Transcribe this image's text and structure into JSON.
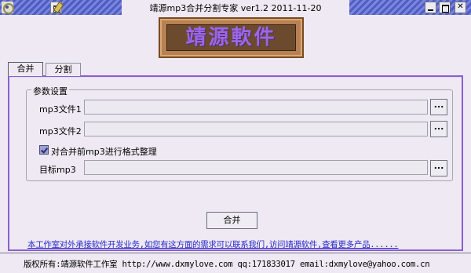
{
  "window": {
    "title": "靖源mp3合并分割专家 ver1.2 2011-11-20",
    "minimize_label": "",
    "maximize_label": "",
    "close_label": "✕"
  },
  "logo": {
    "text": "靖源軟件"
  },
  "tabs": [
    {
      "label": "合并",
      "active": true
    },
    {
      "label": "分割",
      "active": false
    }
  ],
  "group": {
    "label": "参数设置",
    "fields": [
      {
        "label": "mp3文件1",
        "value": "",
        "browse_label": "..."
      },
      {
        "label": "mp3文件2",
        "value": "",
        "browse_label": "..."
      },
      {
        "label": "目标mp3",
        "value": "",
        "browse_label": "..."
      }
    ],
    "checkbox": {
      "label": "对合并前mp3进行格式整理",
      "checked": true
    }
  },
  "merge_button": "合并",
  "promo_link": "本工作室对外承接软件开发业务,如您有这方面的需求可以联系我们,访问靖源软件,查看更多产品......",
  "status_bar": "版权所有:靖源软件工作室 http://www.dxmylove.com qq:171833017 email:dxmylove@yahoo.com.cn",
  "colors": {
    "panel_border": "#8a60d0",
    "link": "#2a2acb",
    "title_stripes": "#4f5cc3",
    "logo_text": "#9b67e6"
  }
}
